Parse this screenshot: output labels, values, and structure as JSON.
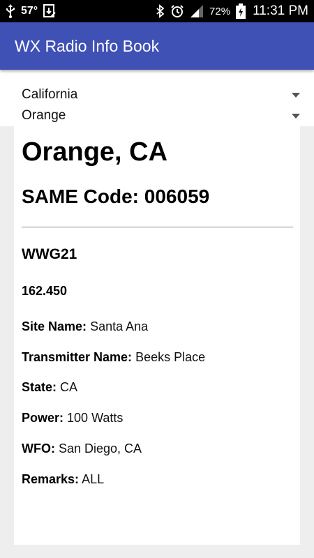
{
  "status_bar": {
    "temperature": "57°",
    "battery_percent": "72%",
    "time": "11:31 PM"
  },
  "app_bar": {
    "title": "WX Radio Info Book",
    "color": "#3f51b5"
  },
  "spinners": {
    "state": "California",
    "county": "Orange"
  },
  "station": {
    "county_title": "Orange, CA",
    "same_code_label": "SAME Code: 006059",
    "call_sign": "WWG21",
    "frequency": "162.450",
    "details": [
      {
        "label": "Site Name:",
        "value": "Santa Ana"
      },
      {
        "label": "Transmitter Name:",
        "value": "Beeks Place"
      },
      {
        "label": "State:",
        "value": "CA"
      },
      {
        "label": "Power:",
        "value": "100 Watts"
      },
      {
        "label": "WFO:",
        "value": "San Diego, CA"
      },
      {
        "label": "Remarks:",
        "value": "ALL"
      }
    ]
  },
  "icons": [
    "usb-icon",
    "download-icon",
    "bluetooth-icon",
    "alarm-icon",
    "signal-icon",
    "battery-charging-icon"
  ]
}
